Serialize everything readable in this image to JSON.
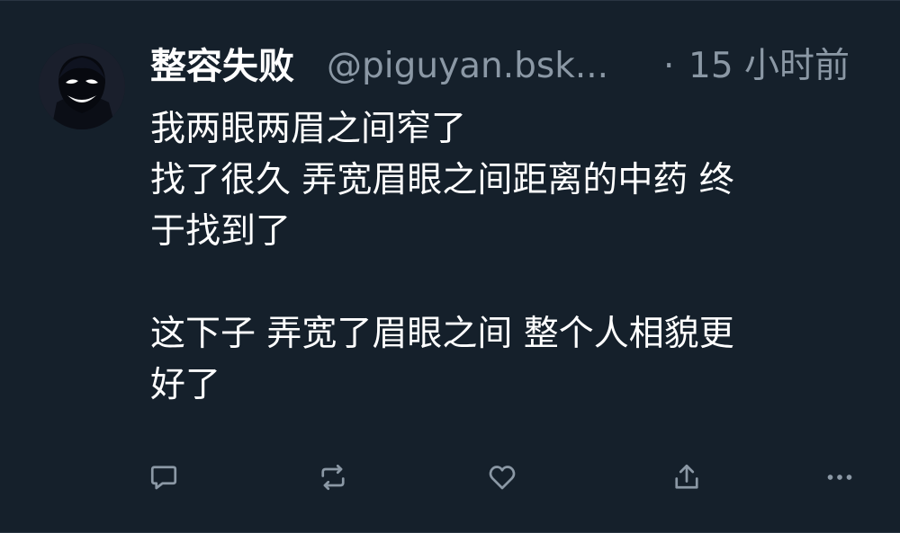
{
  "post": {
    "author": {
      "display_name": "整容失败",
      "handle": "@piguyan.bsk...",
      "avatar_icon": "anime-villain-avatar"
    },
    "separator": "·",
    "timestamp": "15 小时前",
    "lines": [
      "我两眼两眉之间窄了",
      "找了很久 弄宽眉眼之间距离的中药 终",
      "于找到了",
      "",
      "这下子 弄宽了眉眼之间 整个人相貌更",
      "好了"
    ]
  },
  "actions": [
    {
      "name": "reply-icon"
    },
    {
      "name": "repost-icon"
    },
    {
      "name": "like-icon"
    },
    {
      "name": "share-icon"
    },
    {
      "name": "more-icon"
    }
  ],
  "colors": {
    "background": "#15202b",
    "text": "#ffffff",
    "secondary": "#8b98a5",
    "divider": "#2a3542"
  }
}
